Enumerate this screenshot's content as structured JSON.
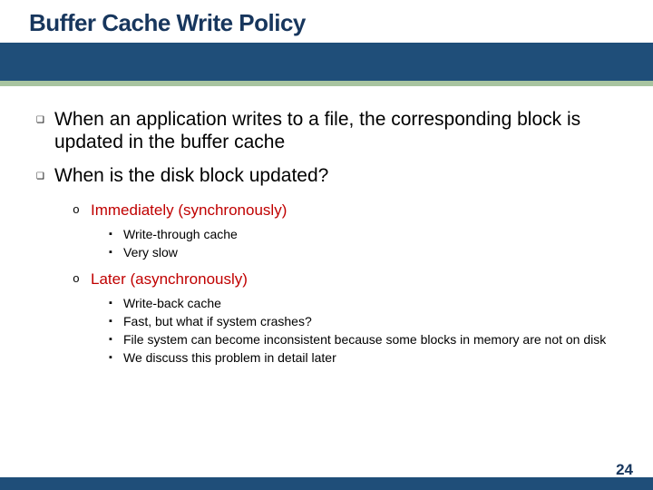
{
  "title": "Buffer Cache Write Policy",
  "bullets": [
    "When an application writes to a file, the corresponding block is updated in the buffer cache",
    "When is the disk block updated?"
  ],
  "options": [
    {
      "label": "Immediately (synchronously)",
      "subs": [
        "Write-through cache",
        "Very slow"
      ]
    },
    {
      "label": "Later (asynchronously)",
      "subs": [
        "Write-back cache",
        "Fast, but what if system crashes?",
        "File system can become inconsistent because some blocks in memory are not on disk",
        "We discuss this problem in detail later"
      ]
    }
  ],
  "page": "24"
}
